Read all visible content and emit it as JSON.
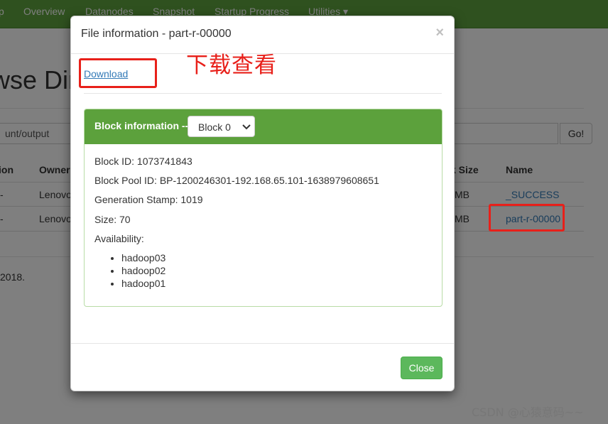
{
  "navbar": {
    "items": [
      "p",
      "Overview",
      "Datanodes",
      "Snapshot",
      "Startup Progress",
      "Utilities ▾"
    ]
  },
  "background": {
    "page_title": "wse Dir",
    "path_value": "unt/output",
    "go_label": "Go!",
    "headers": {
      "permission": "ion",
      "owner": "Owner",
      "block_size": "k Size",
      "name": "Name"
    },
    "rows": [
      {
        "permission": "-",
        "owner": "Lenovo",
        "block_size": "MB",
        "name": "_SUCCESS"
      },
      {
        "permission": "-",
        "owner": "Lenovo",
        "block_size": "MB",
        "name": "part-r-00000"
      }
    ],
    "footer": "2018."
  },
  "modal": {
    "title": "File information - part-r-00000",
    "close_x": "×",
    "download_label": "Download",
    "panel": {
      "title": "Block information --",
      "selected_block": "Block 0",
      "block_id": "Block ID: 1073741843",
      "block_pool_id": "Block Pool ID: BP-1200246301-192.168.65.101-1638979608651",
      "generation_stamp": "Generation Stamp: 1019",
      "size": "Size: 70",
      "availability_label": "Availability:",
      "availability": [
        "hadoop03",
        "hadoop02",
        "hadoop01"
      ]
    },
    "close_label": "Close"
  },
  "annotation": {
    "text": "下载查看"
  },
  "watermark": "CSDN @心猿意码~~",
  "colors": {
    "navbar": "#5fa33e",
    "panel_heading": "#5ca13c",
    "close_button": "#5cb85c",
    "annotation": "#e8201a",
    "link": "#337ab7"
  }
}
